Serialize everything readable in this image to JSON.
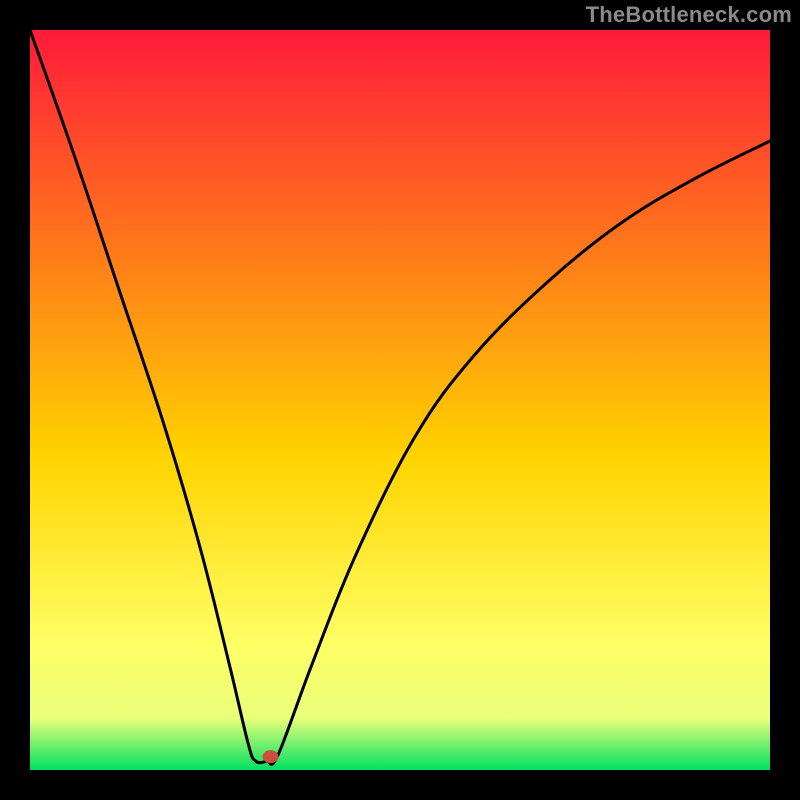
{
  "watermark": "TheBottleneck.com",
  "chart_data": {
    "type": "line",
    "title": "",
    "xlabel": "",
    "ylabel": "",
    "xlim": [
      0,
      100
    ],
    "ylim": [
      0,
      100
    ],
    "gradient_colors": {
      "top": "#ff1a3a",
      "upper_mid": "#ff7a1a",
      "mid": "#ffd400",
      "lower_mid": "#ffff66",
      "bottom": "#00e060"
    },
    "series": [
      {
        "name": "bottleneck-curve",
        "type": "line",
        "color": "#000000",
        "points": [
          {
            "x": 0,
            "y": 100
          },
          {
            "x": 6,
            "y": 83
          },
          {
            "x": 12,
            "y": 65
          },
          {
            "x": 18,
            "y": 47
          },
          {
            "x": 23,
            "y": 30
          },
          {
            "x": 27,
            "y": 14
          },
          {
            "x": 29.5,
            "y": 3.5
          },
          {
            "x": 30.5,
            "y": 1.2
          },
          {
            "x": 32.0,
            "y": 1.2
          },
          {
            "x": 33.5,
            "y": 2.0
          },
          {
            "x": 38,
            "y": 14
          },
          {
            "x": 44,
            "y": 29
          },
          {
            "x": 52,
            "y": 45
          },
          {
            "x": 60,
            "y": 56
          },
          {
            "x": 70,
            "y": 66
          },
          {
            "x": 80,
            "y": 74
          },
          {
            "x": 90,
            "y": 80
          },
          {
            "x": 100,
            "y": 85
          }
        ]
      },
      {
        "name": "marker-dot",
        "type": "scatter",
        "color": "#cc4e3e",
        "points": [
          {
            "x": 32.5,
            "y": 1.8
          }
        ]
      }
    ]
  }
}
